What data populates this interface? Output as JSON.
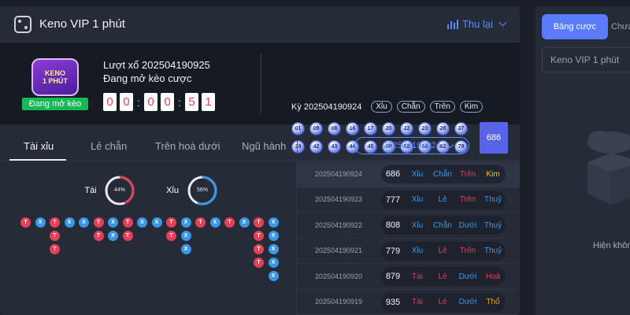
{
  "header": {
    "title": "Keno VIP 1 phút",
    "replay_label": "Thu lại"
  },
  "logo": {
    "line1": "KENO",
    "line2": "1 PHÚT",
    "status": "Đang mở kèo"
  },
  "draw": {
    "round_text": "Lượt xổ 202504190925",
    "status_text": "Đang mở kèo cược",
    "countdown": [
      "0",
      "0",
      "0",
      "0",
      "5",
      "1"
    ]
  },
  "period": {
    "label": "Kỳ 202504190924",
    "tags": [
      "Xỉu",
      "Chẵn",
      "Trên",
      "Kim"
    ],
    "balls": [
      "01",
      "09",
      "08",
      "16",
      "17",
      "20",
      "22",
      "23",
      "28",
      "37",
      "39",
      "42",
      "43",
      "44",
      "45",
      "50",
      "52",
      "53",
      "62",
      "79"
    ],
    "sum": "686"
  },
  "tabs": {
    "items": [
      "Tài xỉu",
      "Lẻ chẵn",
      "Trên hoà dưới",
      "Ngũ hành"
    ],
    "selected_period": "202504190924"
  },
  "stats": {
    "tai_label": "Tài",
    "tai_percent": "44%",
    "xiu_label": "Xỉu",
    "xiu_percent": "56%",
    "tai_value": 44,
    "xiu_value": 56,
    "colors": {
      "tai": "#e5405a",
      "xiu": "#3b97e6"
    },
    "road": [
      [
        "T"
      ],
      [
        "X"
      ],
      [
        "T",
        "T",
        "T"
      ],
      [
        "X"
      ],
      [
        "X"
      ],
      [
        "T",
        "T"
      ],
      [
        "X",
        "X"
      ],
      [
        "T",
        "T"
      ],
      [
        "X"
      ],
      [
        "X"
      ],
      [
        "T",
        "T"
      ],
      [
        "X",
        "X",
        "X"
      ],
      [
        "T"
      ],
      [
        "X"
      ],
      [
        "T"
      ],
      [
        "X"
      ],
      [
        "T",
        "T",
        "T",
        "T"
      ],
      [
        "X",
        "X",
        "X",
        "X",
        "X"
      ]
    ]
  },
  "history": [
    {
      "period": "202504190924",
      "sum": "686",
      "tags": [
        [
          "Xỉu",
          "#3b97e6"
        ],
        [
          "Chẵn",
          "#3b97e6"
        ],
        [
          "Trên",
          "#e5405a"
        ],
        [
          "Kim",
          "#f0c419"
        ]
      ]
    },
    {
      "period": "202504190923",
      "sum": "777",
      "tags": [
        [
          "Xỉu",
          "#3b97e6"
        ],
        [
          "Lẻ",
          "#3b97e6"
        ],
        [
          "Trên",
          "#e5405a"
        ],
        [
          "Thuỷ",
          "#3b97e6"
        ]
      ]
    },
    {
      "period": "202504190922",
      "sum": "808",
      "tags": [
        [
          "Xỉu",
          "#3b97e6"
        ],
        [
          "Chẵn",
          "#3b97e6"
        ],
        [
          "Dưới",
          "#3b97e6"
        ],
        [
          "Thuỷ",
          "#3b97e6"
        ]
      ]
    },
    {
      "period": "202504190921",
      "sum": "779",
      "tags": [
        [
          "Xỉu",
          "#3b97e6"
        ],
        [
          "Lẻ",
          "#e5405a"
        ],
        [
          "Trên",
          "#e5405a"
        ],
        [
          "Thuỷ",
          "#3b97e6"
        ]
      ]
    },
    {
      "period": "202504190920",
      "sum": "879",
      "tags": [
        [
          "Tài",
          "#e5405a"
        ],
        [
          "Lẻ",
          "#e5405a"
        ],
        [
          "Dưới",
          "#3b97e6"
        ],
        [
          "Hoả",
          "#e5405a"
        ]
      ]
    },
    {
      "period": "202504190919",
      "sum": "935",
      "tags": [
        [
          "Tài",
          "#e5405a"
        ],
        [
          "Lẻ",
          "#e5405a"
        ],
        [
          "Dưới",
          "#3b97e6"
        ],
        [
          "Thổ",
          "#e8a21a"
        ]
      ]
    }
  ],
  "side": {
    "tab_active": "Bảng cược",
    "tab_other": "Chưa",
    "game_name": "Keno VIP 1 phút",
    "empty_text": "Hiện khôn"
  }
}
